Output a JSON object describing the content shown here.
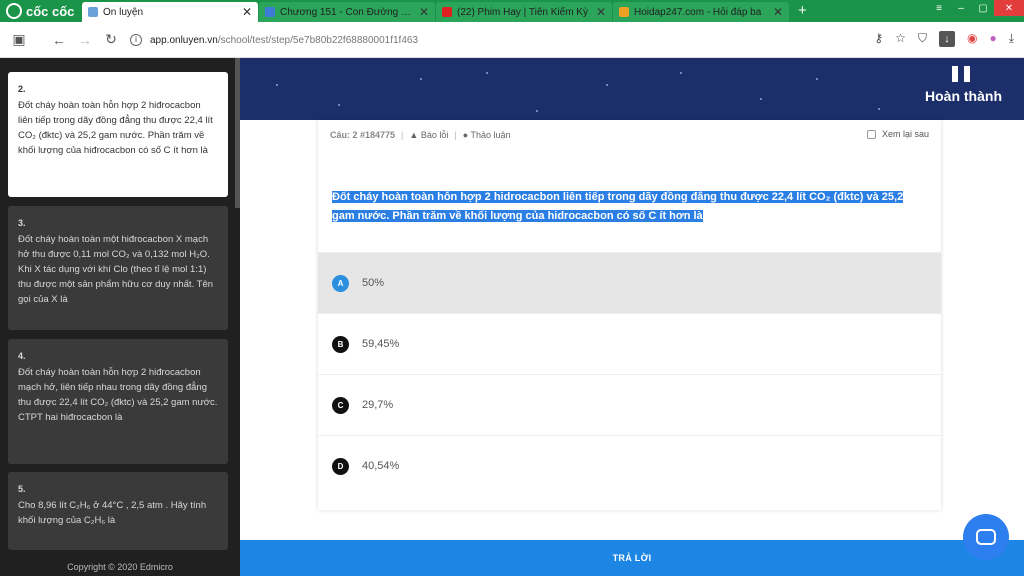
{
  "browser": {
    "brand": "cốc cốc",
    "tabs": [
      {
        "title": "Ôn luyện",
        "active": true,
        "fav_color": "#6aa0d8"
      },
      {
        "title": "Chương 151 - Con Đường Bá",
        "active": false,
        "fav_color": "#3e7bd6"
      },
      {
        "title": "(22) Phim Hay | Tiên Kiếm Kỳ",
        "active": false,
        "fav_color": "#e02020"
      },
      {
        "title": "Hoidap247.com - Hỏi đáp ba",
        "active": false,
        "fav_color": "#f0a020"
      }
    ],
    "url_host": "app.onluyen.vn",
    "url_path": "/school/test/step/5e7b80b22f68880001f1f463"
  },
  "sidebar": {
    "items": [
      {
        "num": "2.",
        "text": "Đốt cháy hoàn toàn hỗn hợp 2 hiđrocacbon liên tiếp trong dãy đồng đẳng thu được 22,4 lít CO₂ (đktc) và 25,2 gam nước. Phần trăm về khối lượng của hiđrocacbon có số C ít hơn là",
        "active": true
      },
      {
        "num": "3.",
        "text": "Đốt cháy hoàn toàn một hiđrocacbon X mạch hở thu được 0,11 mol CO₂ và 0,132 mol H₂O. Khi X tác dụng với khí Clo (theo tỉ lệ mol 1:1) thu được một sản phẩm hữu cơ duy nhất. Tên gọi của X là",
        "active": false
      },
      {
        "num": "4.",
        "text": "Đốt cháy hoàn toàn hỗn hợp 2 hiđrocacbon mạch hở, liên tiếp nhau trong dãy đồng đẳng thu được 22,4 lít CO₂ (đktc) và 25,2 gam nước. CTPT hai hiđrocacbon là",
        "active": false
      },
      {
        "num": "5.",
        "text": "Cho 8,96 lít C₂H₆ ở 44°C , 2,5 atm . Hãy tính khối lượng của C₂H₆ là",
        "active": false
      }
    ],
    "copyright": "Copyright © 2020 Edmicro"
  },
  "header": {
    "finish_label": "Hoàn thành"
  },
  "question": {
    "number_label": "Câu: 2 #184775",
    "report_label": "Báo lỗi",
    "discuss_label": "Thảo luận",
    "review_label": "Xem lại sau",
    "text": "Đốt cháy hoàn toàn hỗn hợp 2 hidrocacbon liên tiếp trong dãy đồng đẳng thu được 22,4 lít CO₂ (đktc) và 25,2 gam nước. Phần trăm về khối lượng của hidrocacbon có số C ít hơn là",
    "options": [
      {
        "letter": "A",
        "text": "50%",
        "selected": true
      },
      {
        "letter": "B",
        "text": "59,45%",
        "selected": false
      },
      {
        "letter": "C",
        "text": "29,7%",
        "selected": false
      },
      {
        "letter": "D",
        "text": "40,54%",
        "selected": false
      }
    ]
  },
  "footer": {
    "answer_label": "TRẢ LỜI"
  },
  "colors": {
    "header_bg": "#1c2f6a",
    "accent": "#1d86e5",
    "browser_green": "#1a9448"
  }
}
